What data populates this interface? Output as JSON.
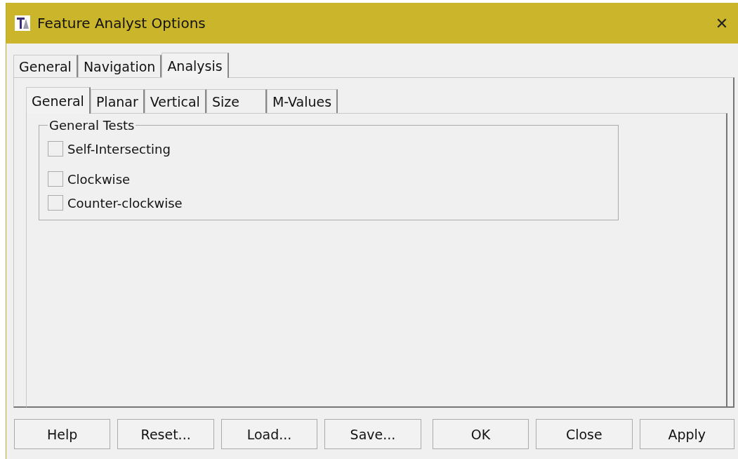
{
  "window": {
    "title": "Feature Analyst Options",
    "close": "✕"
  },
  "tabs": [
    {
      "label": "General",
      "selected": false
    },
    {
      "label": "Navigation",
      "selected": false
    },
    {
      "label": "Analysis",
      "selected": true
    }
  ],
  "subtabs": [
    {
      "label": "General",
      "selected": true
    },
    {
      "label": "Planar",
      "selected": false
    },
    {
      "label": "Vertical",
      "selected": false
    },
    {
      "label": "Size",
      "selected": false
    },
    {
      "label": "M-Values",
      "selected": false
    }
  ],
  "group": {
    "title": "General Tests",
    "options": [
      {
        "label": "Self-Intersecting",
        "checked": false
      },
      {
        "label": "Clockwise",
        "checked": false
      },
      {
        "label": "Counter-clockwise",
        "checked": false
      }
    ]
  },
  "buttons": [
    "Help",
    "Reset...",
    "Load...",
    "Save...",
    "OK",
    "Close",
    "Apply"
  ]
}
